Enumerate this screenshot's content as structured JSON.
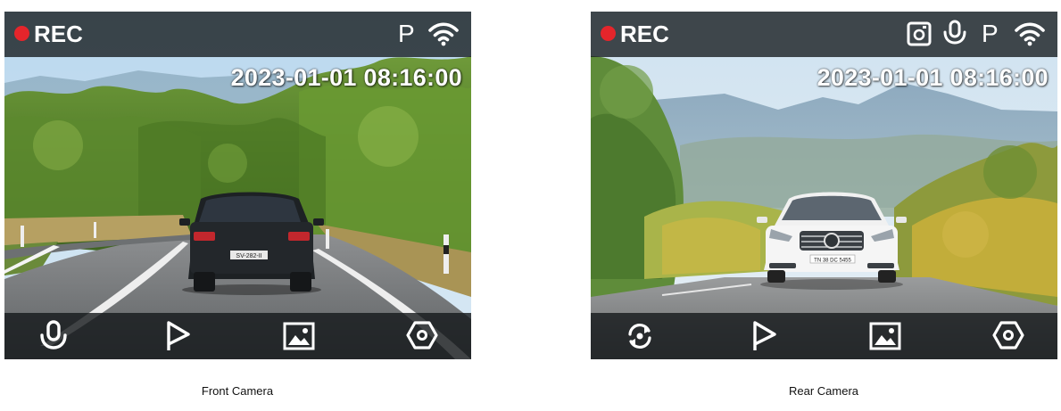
{
  "front_camera": {
    "rec_label": "REC",
    "parking_label": "P",
    "timestamp": "2023-01-01 08:16:00",
    "license_plate": "SV-282-II",
    "status_icons": [
      "parking-indicator",
      "wifi-icon"
    ],
    "toolbar_icons": [
      "microphone-icon",
      "flag-icon",
      "gallery-icon",
      "settings-icon"
    ],
    "caption": "Front Camera"
  },
  "rear_camera": {
    "rec_label": "REC",
    "parking_label": "P",
    "timestamp": "2023-01-01 08:16:00",
    "license_plate": "TN 38 DC 5455",
    "status_icons": [
      "photo-icon",
      "microphone-icon",
      "parking-indicator",
      "wifi-icon"
    ],
    "toolbar_icons": [
      "switch-camera-icon",
      "flag-icon",
      "gallery-icon",
      "settings-icon"
    ],
    "caption": "Rear Camera"
  },
  "colors": {
    "rec_dot": "#e5252b",
    "bar_background": "#141a1c",
    "icon": "#ffffff"
  }
}
